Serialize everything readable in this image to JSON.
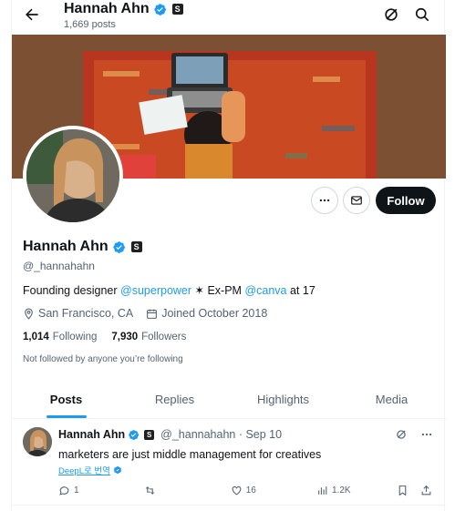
{
  "header": {
    "name": "Hannah Ahn",
    "posts_count": "1,669 posts",
    "back_icon": "arrow-left-icon",
    "grok_icon": "grok-icon",
    "search_icon": "search-icon"
  },
  "profile": {
    "name": "Hannah Ahn",
    "badge": "S",
    "handle": "@_hannahahn",
    "bio_prefix": "Founding designer ",
    "bio_link1": "@superpower",
    "bio_mid": " ✶ Ex-PM ",
    "bio_link2": "@canva",
    "bio_suffix": " at 17",
    "location": "San Francisco, CA",
    "joined": "Joined October 2018",
    "following_count": "1,014",
    "following_label": "Following",
    "followers_count": "7,930",
    "followers_label": "Followers",
    "not_followed": "Not followed by anyone you’re following"
  },
  "actions": {
    "more_icon": "more-icon",
    "message_icon": "envelope-icon",
    "follow_label": "Follow"
  },
  "tabs": [
    {
      "label": "Posts",
      "active": true
    },
    {
      "label": "Replies",
      "active": false
    },
    {
      "label": "Highlights",
      "active": false
    },
    {
      "label": "Media",
      "active": false
    }
  ],
  "tweet": {
    "name": "Hannah Ahn",
    "badge": "S",
    "handle_date": "@_hannahahn · Sep 10",
    "text": "marketers are just middle management for creatives",
    "translate": "DeepL로 번역",
    "replies": "1",
    "reposts": "",
    "likes": "16",
    "views": "1.2K"
  },
  "colors": {
    "accent": "#1d9bf0",
    "text": "#0f1419",
    "muted": "#536471"
  }
}
